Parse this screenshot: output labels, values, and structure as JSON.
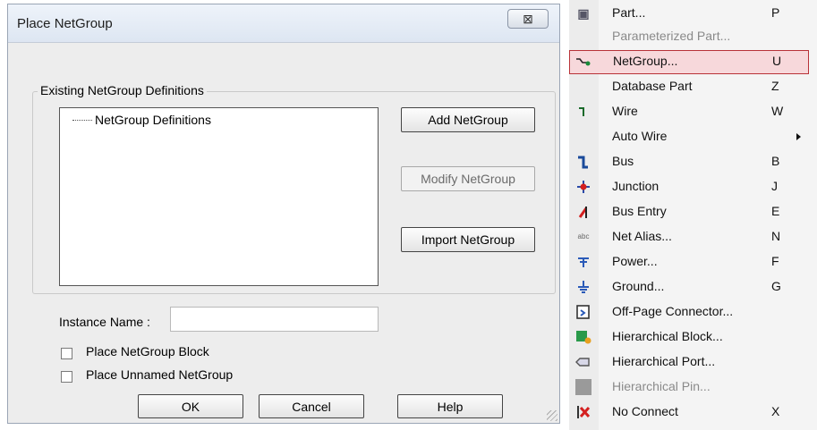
{
  "dialog": {
    "title": "Place NetGroup",
    "close_symbol": "⊠",
    "group_label": "Existing NetGroup Definitions",
    "tree_item": "NetGroup Definitions",
    "buttons": {
      "add": "Add NetGroup",
      "modify": "Modify NetGroup",
      "import": "Import NetGroup",
      "ok": "OK",
      "cancel": "Cancel",
      "help": "Help"
    },
    "instance_label": "Instance Name :",
    "instance_value": "",
    "checkboxes": {
      "block": "Place NetGroup Block",
      "unnamed": "Place Unnamed NetGroup"
    }
  },
  "menu": {
    "items": [
      {
        "label": "Part...",
        "key": "P",
        "icon": "part-icon",
        "disabled": false
      },
      {
        "label": "Parameterized Part...",
        "key": "",
        "icon": "",
        "disabled": true
      },
      {
        "label": "NetGroup...",
        "key": "U",
        "icon": "netgroup-icon",
        "disabled": false,
        "highlighted": true
      },
      {
        "label": "Database Part",
        "key": "Z",
        "icon": "",
        "disabled": false
      },
      {
        "label": "Wire",
        "key": "W",
        "icon": "wire-icon",
        "disabled": false
      },
      {
        "label": "Auto Wire",
        "key": "",
        "icon": "",
        "disabled": false,
        "submenu": true
      },
      {
        "label": "Bus",
        "key": "B",
        "icon": "bus-icon",
        "disabled": false
      },
      {
        "label": "Junction",
        "key": "J",
        "icon": "junction-icon",
        "disabled": false
      },
      {
        "label": "Bus Entry",
        "key": "E",
        "icon": "bus-entry-icon",
        "disabled": false
      },
      {
        "label": "Net Alias...",
        "key": "N",
        "icon": "net-alias-icon",
        "disabled": false
      },
      {
        "label": "Power...",
        "key": "F",
        "icon": "power-icon",
        "disabled": false
      },
      {
        "label": "Ground...",
        "key": "G",
        "icon": "ground-icon",
        "disabled": false
      },
      {
        "label": "Off-Page Connector...",
        "key": "",
        "icon": "off-page-connector-icon",
        "disabled": false
      },
      {
        "label": "Hierarchical Block...",
        "key": "",
        "icon": "hierarchical-block-icon",
        "disabled": false
      },
      {
        "label": "Hierarchical Port...",
        "key": "",
        "icon": "hierarchical-port-icon",
        "disabled": false
      },
      {
        "label": "Hierarchical Pin...",
        "key": "",
        "icon": "hierarchical-pin-icon",
        "disabled": true
      },
      {
        "label": "No Connect",
        "key": "X",
        "icon": "no-connect-icon",
        "disabled": false
      }
    ]
  },
  "colors": {
    "highlight_bg": "#f7d8db",
    "highlight_border": "#b83238"
  }
}
